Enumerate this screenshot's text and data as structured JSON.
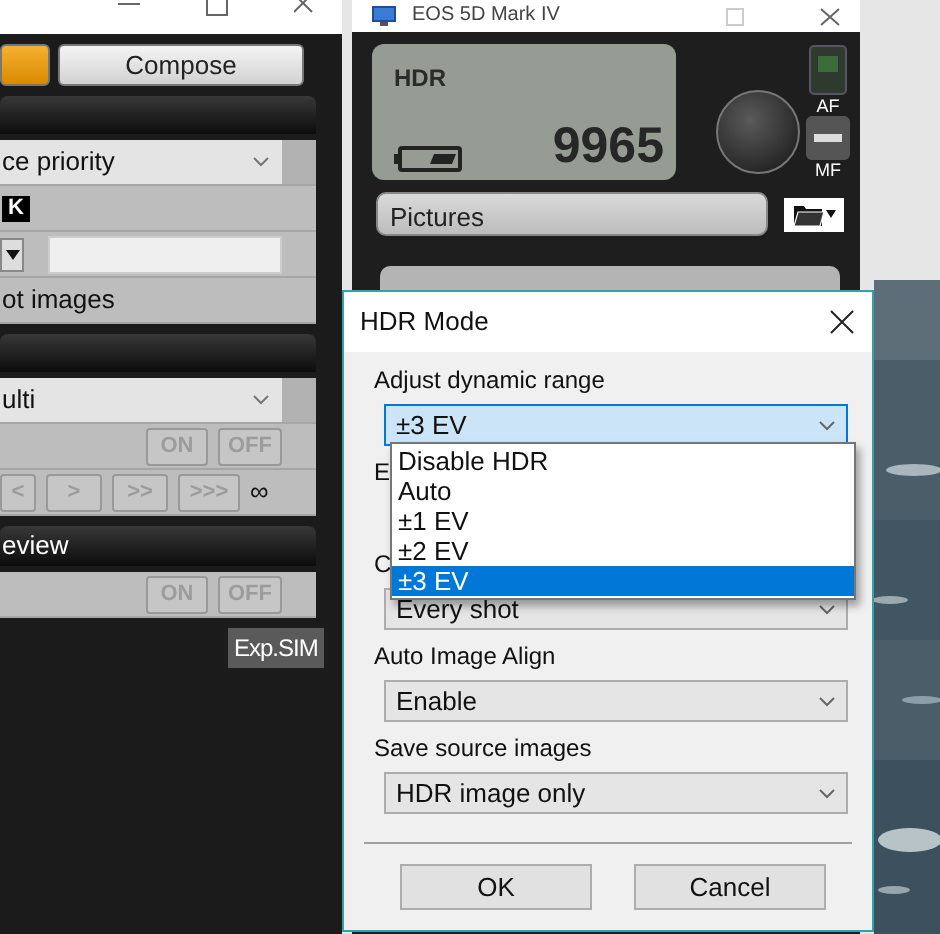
{
  "control_window": {
    "mode_tabs": [
      {
        "selected": true
      },
      {
        "label": "Compose",
        "selected": false
      }
    ],
    "sections": [
      {
        "rows": [
          {
            "kind": "select",
            "value": "ce priority"
          },
          {
            "kind": "badge",
            "text": "K"
          },
          {
            "kind": "field"
          },
          {
            "kind": "text",
            "text": "ot images"
          }
        ]
      },
      {
        "rows": [
          {
            "kind": "select",
            "value": "ulti"
          },
          {
            "kind": "toggle",
            "labels": [
              "ON",
              "OFF"
            ],
            "disabled": true
          },
          {
            "kind": "steps",
            "labels": [
              "<",
              ">",
              ">>",
              ">>>"
            ],
            "suffix": "∞",
            "disabled": true
          }
        ]
      },
      {
        "header": "eview",
        "rows": [
          {
            "kind": "toggle",
            "labels": [
              "ON",
              "OFF"
            ],
            "disabled": true
          }
        ]
      }
    ],
    "badge": "Exp.SIM"
  },
  "camera_window": {
    "title": "EOS 5D Mark IV",
    "lcd": {
      "mode": "HDR",
      "shots": "9965"
    },
    "focus_switch": [
      "AF",
      "MF"
    ],
    "folder": "Pictures"
  },
  "dialog": {
    "title": "HDR Mode",
    "fields": [
      {
        "label": "Adjust dynamic range",
        "value": "±3 EV",
        "focused": true,
        "open": true,
        "options": [
          {
            "label": "Disable HDR",
            "selected": false
          },
          {
            "label": "Auto",
            "selected": false
          },
          {
            "label": "±1 EV",
            "selected": false
          },
          {
            "label": "±2 EV",
            "selected": false
          },
          {
            "label": "±3 EV",
            "selected": true
          }
        ]
      },
      {
        "label": "E"
      },
      {
        "label": "C",
        "value": "Every shot",
        "focused": false
      },
      {
        "label": "Auto Image Align",
        "value": "Enable",
        "focused": false
      },
      {
        "label": "Save source images",
        "value": "HDR image only",
        "focused": false
      }
    ],
    "buttons": [
      "OK",
      "Cancel"
    ]
  }
}
